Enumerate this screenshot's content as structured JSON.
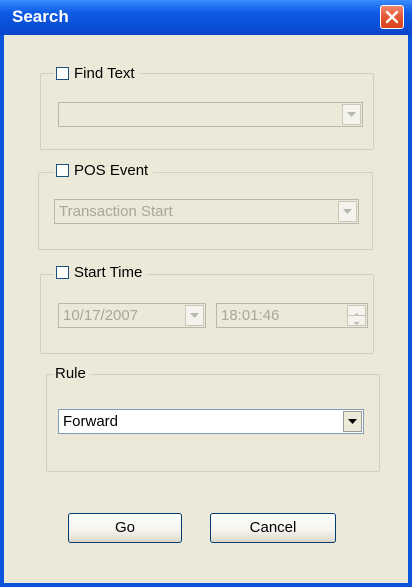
{
  "window": {
    "title": "Search"
  },
  "find_text": {
    "label": "Find Text",
    "checked": false,
    "value": "",
    "enabled": false
  },
  "pos_event": {
    "label": "POS Event",
    "checked": false,
    "value": "Transaction Start",
    "enabled": false
  },
  "start_time": {
    "label": "Start Time",
    "checked": false,
    "date": "10/17/2007",
    "time": "18:01:46",
    "enabled": false
  },
  "rule": {
    "label": "Rule",
    "value": "Forward"
  },
  "buttons": {
    "go": "Go",
    "cancel": "Cancel"
  },
  "colors": {
    "titlebar": "#0a4fd8",
    "client": "#ece9d8",
    "close": "#e3542f"
  }
}
